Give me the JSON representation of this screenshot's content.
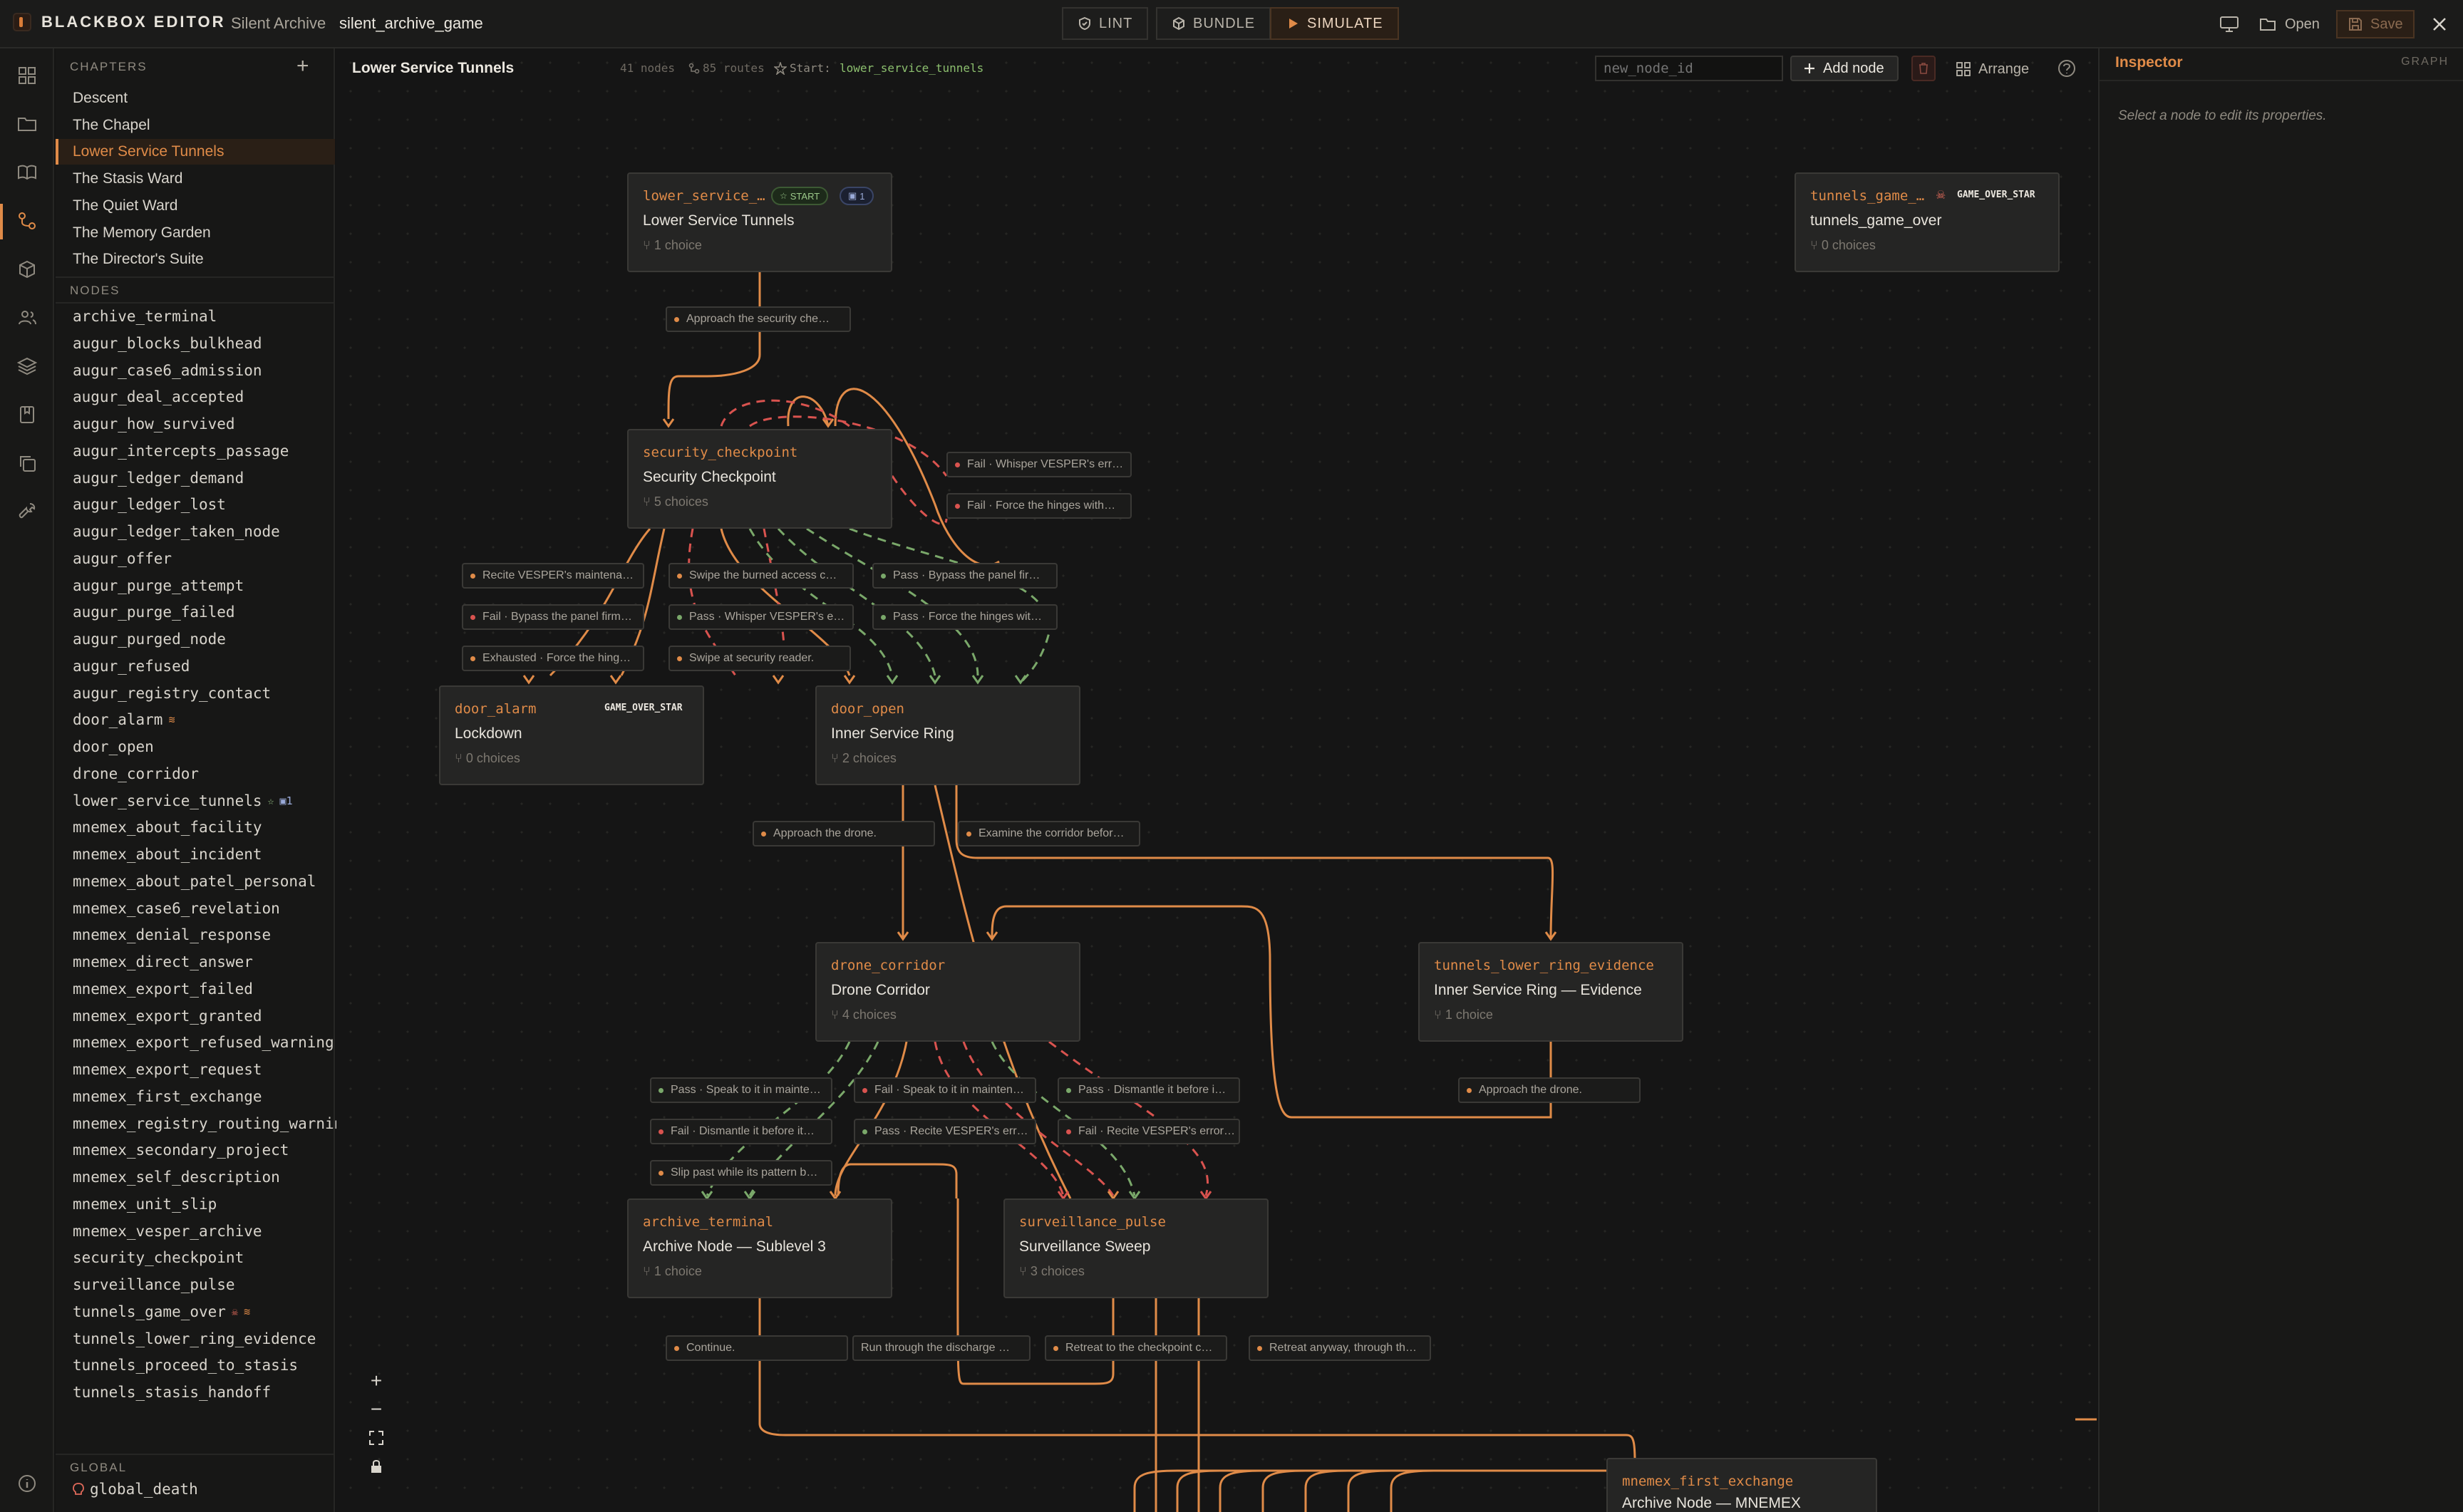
{
  "app": {
    "brand": "BLACKBOX EDITOR",
    "project_name": "Silent Archive",
    "project_id": "silent_archive_game"
  },
  "toolbar": {
    "lint": "LINT",
    "bundle": "BUNDLE",
    "simulate": "SIMULATE",
    "open": "Open",
    "save": "Save"
  },
  "chapters": {
    "header": "CHAPTERS",
    "items": [
      "Descent",
      "The Chapel",
      "Lower Service Tunnels",
      "The Stasis Ward",
      "The Quiet Ward",
      "The Memory Garden",
      "The Director's Suite"
    ],
    "selected": "Lower Service Tunnels"
  },
  "nodes_list": {
    "header": "NODES",
    "items": [
      "archive_terminal",
      "augur_blocks_bulkhead",
      "augur_case6_admission",
      "augur_deal_accepted",
      "augur_how_survived",
      "augur_intercepts_passage",
      "augur_ledger_demand",
      "augur_ledger_lost",
      "augur_ledger_taken_node",
      "augur_offer",
      "augur_purge_attempt",
      "augur_purge_failed",
      "augur_purged_node",
      "augur_refused",
      "augur_registry_contact",
      "door_alarm",
      "door_open",
      "drone_corridor",
      "lower_service_tunnels",
      "mnemex_about_facility",
      "mnemex_about_incident",
      "mnemex_about_patel_personal",
      "mnemex_case6_revelation",
      "mnemex_denial_response",
      "mnemex_direct_answer",
      "mnemex_export_failed",
      "mnemex_export_granted",
      "mnemex_export_refused_warning",
      "mnemex_export_request",
      "mnemex_first_exchange",
      "mnemex_registry_routing_warning",
      "mnemex_secondary_project",
      "mnemex_self_description",
      "mnemex_unit_slip",
      "mnemex_vesper_archive",
      "security_checkpoint",
      "surveillance_pulse",
      "tunnels_game_over",
      "tunnels_lower_ring_evidence",
      "tunnels_proceed_to_stasis",
      "tunnels_stasis_handoff"
    ],
    "lst_badge": "1"
  },
  "global": {
    "header": "GLOBAL",
    "items": [
      "global_death"
    ]
  },
  "canvas": {
    "title": "Lower Service Tunnels",
    "node_count": "41 nodes",
    "route_count": "85 routes",
    "start_label": "Start:",
    "start_node": "lower_service_tunnels",
    "new_node_placeholder": "new_node_id",
    "add_node": "Add node",
    "arrange": "Arrange"
  },
  "graph_nodes": {
    "lst": {
      "id": "lower_service_…",
      "title": "Lower Service Tunnels",
      "choices": "1 choice",
      "start_tag": "START",
      "count_tag": "1"
    },
    "tgo": {
      "id": "tunnels_game_…",
      "title": "tunnels_game_over",
      "choices": "0 choices",
      "tag": "GAME_OVER_STAR"
    },
    "sc": {
      "id": "security_checkpoint",
      "title": "Security Checkpoint",
      "choices": "5 choices"
    },
    "da": {
      "id": "door_alarm",
      "title": "Lockdown",
      "choices": "0 choices",
      "tag": "GAME_OVER_STAR"
    },
    "do": {
      "id": "door_open",
      "title": "Inner Service Ring",
      "choices": "2 choices"
    },
    "dc": {
      "id": "drone_corridor",
      "title": "Drone Corridor",
      "choices": "4 choices"
    },
    "tlre": {
      "id": "tunnels_lower_ring_evidence",
      "title": "Inner Service Ring — Evidence",
      "choices": "1 choice"
    },
    "at": {
      "id": "archive_terminal",
      "title": "Archive Node — Sublevel 3",
      "choices": "1 choice"
    },
    "sp": {
      "id": "surveillance_pulse",
      "title": "Surveillance Sweep",
      "choices": "3 choices"
    },
    "mfe": {
      "id": "mnemex_first_exchange",
      "title": "Archive Node — MNEMEX"
    }
  },
  "edge_labels": [
    "Approach the security che…",
    "Fail · Whisper VESPER's err…",
    "Fail · Force the hinges with…",
    "Recite VESPER's maintena…",
    "Swipe the burned access c…",
    "Pass · Bypass the panel fir…",
    "Fail · Bypass the panel firm…",
    "Pass · Whisper VESPER's e…",
    "Pass · Force the hinges wit…",
    "Exhausted · Force the hing…",
    "Swipe at security reader.",
    "Approach the drone.",
    "Examine the corridor befor…",
    "Pass · Speak to it in mainte…",
    "Fail · Speak to it in mainten…",
    "Pass · Dismantle it before i…",
    "Approach the drone.",
    "Fail · Dismantle it before it…",
    "Pass · Recite VESPER's err…",
    "Fail · Recite VESPER's error…",
    "Slip past while its pattern b…",
    "Continue.",
    "Run through the discharge …",
    "Retreat to the checkpoint c…",
    "Retreat anyway, through th…"
  ],
  "inspector": {
    "title": "Inspector",
    "mode": "GRAPH",
    "hint": "Select a node to edit its properties."
  },
  "colors": {
    "accent": "#e08b48",
    "pass": "#7aa86a",
    "fail": "#d9534f",
    "bg": "#151515"
  }
}
